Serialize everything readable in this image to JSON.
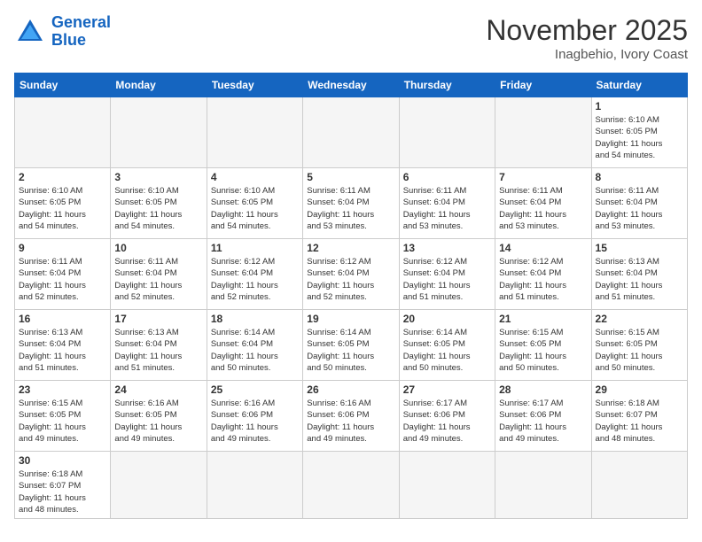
{
  "header": {
    "logo_general": "General",
    "logo_blue": "Blue",
    "month_title": "November 2025",
    "location": "Inagbehio, Ivory Coast"
  },
  "days_of_week": [
    "Sunday",
    "Monday",
    "Tuesday",
    "Wednesday",
    "Thursday",
    "Friday",
    "Saturday"
  ],
  "weeks": [
    [
      {
        "day": "",
        "info": ""
      },
      {
        "day": "",
        "info": ""
      },
      {
        "day": "",
        "info": ""
      },
      {
        "day": "",
        "info": ""
      },
      {
        "day": "",
        "info": ""
      },
      {
        "day": "",
        "info": ""
      },
      {
        "day": "1",
        "info": "Sunrise: 6:10 AM\nSunset: 6:05 PM\nDaylight: 11 hours\nand 54 minutes."
      }
    ],
    [
      {
        "day": "2",
        "info": "Sunrise: 6:10 AM\nSunset: 6:05 PM\nDaylight: 11 hours\nand 54 minutes."
      },
      {
        "day": "3",
        "info": "Sunrise: 6:10 AM\nSunset: 6:05 PM\nDaylight: 11 hours\nand 54 minutes."
      },
      {
        "day": "4",
        "info": "Sunrise: 6:10 AM\nSunset: 6:05 PM\nDaylight: 11 hours\nand 54 minutes."
      },
      {
        "day": "5",
        "info": "Sunrise: 6:11 AM\nSunset: 6:04 PM\nDaylight: 11 hours\nand 53 minutes."
      },
      {
        "day": "6",
        "info": "Sunrise: 6:11 AM\nSunset: 6:04 PM\nDaylight: 11 hours\nand 53 minutes."
      },
      {
        "day": "7",
        "info": "Sunrise: 6:11 AM\nSunset: 6:04 PM\nDaylight: 11 hours\nand 53 minutes."
      },
      {
        "day": "8",
        "info": "Sunrise: 6:11 AM\nSunset: 6:04 PM\nDaylight: 11 hours\nand 53 minutes."
      }
    ],
    [
      {
        "day": "9",
        "info": "Sunrise: 6:11 AM\nSunset: 6:04 PM\nDaylight: 11 hours\nand 52 minutes."
      },
      {
        "day": "10",
        "info": "Sunrise: 6:11 AM\nSunset: 6:04 PM\nDaylight: 11 hours\nand 52 minutes."
      },
      {
        "day": "11",
        "info": "Sunrise: 6:12 AM\nSunset: 6:04 PM\nDaylight: 11 hours\nand 52 minutes."
      },
      {
        "day": "12",
        "info": "Sunrise: 6:12 AM\nSunset: 6:04 PM\nDaylight: 11 hours\nand 52 minutes."
      },
      {
        "day": "13",
        "info": "Sunrise: 6:12 AM\nSunset: 6:04 PM\nDaylight: 11 hours\nand 51 minutes."
      },
      {
        "day": "14",
        "info": "Sunrise: 6:12 AM\nSunset: 6:04 PM\nDaylight: 11 hours\nand 51 minutes."
      },
      {
        "day": "15",
        "info": "Sunrise: 6:13 AM\nSunset: 6:04 PM\nDaylight: 11 hours\nand 51 minutes."
      }
    ],
    [
      {
        "day": "16",
        "info": "Sunrise: 6:13 AM\nSunset: 6:04 PM\nDaylight: 11 hours\nand 51 minutes."
      },
      {
        "day": "17",
        "info": "Sunrise: 6:13 AM\nSunset: 6:04 PM\nDaylight: 11 hours\nand 51 minutes."
      },
      {
        "day": "18",
        "info": "Sunrise: 6:14 AM\nSunset: 6:04 PM\nDaylight: 11 hours\nand 50 minutes."
      },
      {
        "day": "19",
        "info": "Sunrise: 6:14 AM\nSunset: 6:05 PM\nDaylight: 11 hours\nand 50 minutes."
      },
      {
        "day": "20",
        "info": "Sunrise: 6:14 AM\nSunset: 6:05 PM\nDaylight: 11 hours\nand 50 minutes."
      },
      {
        "day": "21",
        "info": "Sunrise: 6:15 AM\nSunset: 6:05 PM\nDaylight: 11 hours\nand 50 minutes."
      },
      {
        "day": "22",
        "info": "Sunrise: 6:15 AM\nSunset: 6:05 PM\nDaylight: 11 hours\nand 50 minutes."
      }
    ],
    [
      {
        "day": "23",
        "info": "Sunrise: 6:15 AM\nSunset: 6:05 PM\nDaylight: 11 hours\nand 49 minutes."
      },
      {
        "day": "24",
        "info": "Sunrise: 6:16 AM\nSunset: 6:05 PM\nDaylight: 11 hours\nand 49 minutes."
      },
      {
        "day": "25",
        "info": "Sunrise: 6:16 AM\nSunset: 6:06 PM\nDaylight: 11 hours\nand 49 minutes."
      },
      {
        "day": "26",
        "info": "Sunrise: 6:16 AM\nSunset: 6:06 PM\nDaylight: 11 hours\nand 49 minutes."
      },
      {
        "day": "27",
        "info": "Sunrise: 6:17 AM\nSunset: 6:06 PM\nDaylight: 11 hours\nand 49 minutes."
      },
      {
        "day": "28",
        "info": "Sunrise: 6:17 AM\nSunset: 6:06 PM\nDaylight: 11 hours\nand 49 minutes."
      },
      {
        "day": "29",
        "info": "Sunrise: 6:18 AM\nSunset: 6:07 PM\nDaylight: 11 hours\nand 48 minutes."
      }
    ],
    [
      {
        "day": "30",
        "info": "Sunrise: 6:18 AM\nSunset: 6:07 PM\nDaylight: 11 hours\nand 48 minutes."
      },
      {
        "day": "",
        "info": ""
      },
      {
        "day": "",
        "info": ""
      },
      {
        "day": "",
        "info": ""
      },
      {
        "day": "",
        "info": ""
      },
      {
        "day": "",
        "info": ""
      },
      {
        "day": "",
        "info": ""
      }
    ]
  ]
}
